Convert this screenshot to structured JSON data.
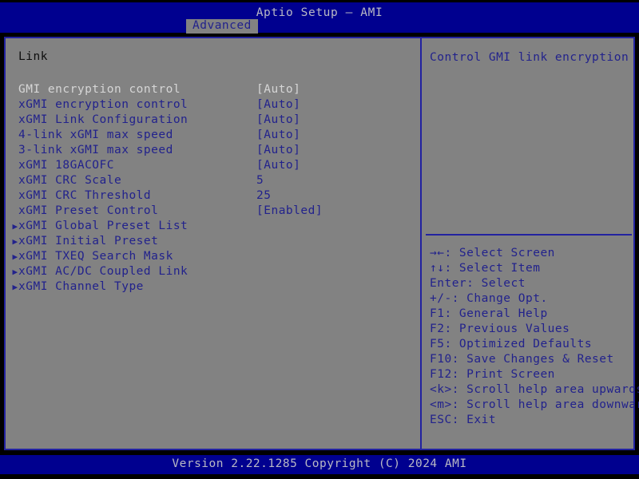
{
  "window": {
    "title": "Aptio Setup – AMI",
    "active_tab": "Advanced"
  },
  "colors": {
    "background": "#000000",
    "title_bar": "#00008f",
    "panel": "#828282",
    "border": "#2222a0",
    "text_blue": "#22228c",
    "text_selected": "#d6d6d6",
    "text_heading": "#0d0d0d",
    "footer_text": "#b9b9c4"
  },
  "main": {
    "section_title": "Link",
    "options": [
      {
        "arrow": "",
        "label": "GMI encryption control",
        "value": "[Auto]",
        "selected": true
      },
      {
        "arrow": "",
        "label": "xGMI encryption control",
        "value": "[Auto]",
        "selected": false
      },
      {
        "arrow": "",
        "label": "xGMI Link Configuration",
        "value": "[Auto]",
        "selected": false
      },
      {
        "arrow": "",
        "label": "4-link xGMI max speed",
        "value": "[Auto]",
        "selected": false
      },
      {
        "arrow": "",
        "label": "3-link xGMI max speed",
        "value": "[Auto]",
        "selected": false
      },
      {
        "arrow": "",
        "label": "xGMI 18GACOFC",
        "value": "[Auto]",
        "selected": false
      },
      {
        "arrow": "",
        "label": "xGMI CRC Scale",
        "value": "5",
        "selected": false
      },
      {
        "arrow": "",
        "label": "xGMI CRC Threshold",
        "value": "25",
        "selected": false
      },
      {
        "arrow": "",
        "label": "xGMI Preset Control",
        "value": "[Enabled]",
        "selected": false
      },
      {
        "arrow": "▶",
        "label": "xGMI Global Preset List",
        "value": "",
        "selected": false
      },
      {
        "arrow": "▶",
        "label": "xGMI Initial Preset",
        "value": "",
        "selected": false
      },
      {
        "arrow": "▶",
        "label": "xGMI TXEQ Search Mask",
        "value": "",
        "selected": false
      },
      {
        "arrow": "▶",
        "label": "xGMI AC/DC Coupled Link",
        "value": "",
        "selected": false
      },
      {
        "arrow": "▶",
        "label": "xGMI Channel Type",
        "value": "",
        "selected": false
      }
    ]
  },
  "help": {
    "description": "Control GMI link encryption",
    "keys": [
      "→←: Select Screen",
      "↑↓: Select Item",
      "Enter: Select",
      "+/-: Change Opt.",
      "F1: General Help",
      "F2: Previous Values",
      "F5: Optimized Defaults",
      "F10: Save Changes & Reset",
      "F12: Print Screen",
      "<k>: Scroll help area upwards",
      "<m>: Scroll help area downwards",
      "ESC: Exit"
    ]
  },
  "footer": {
    "version_text": "Version 2.22.1285 Copyright (C) 2024 AMI"
  }
}
